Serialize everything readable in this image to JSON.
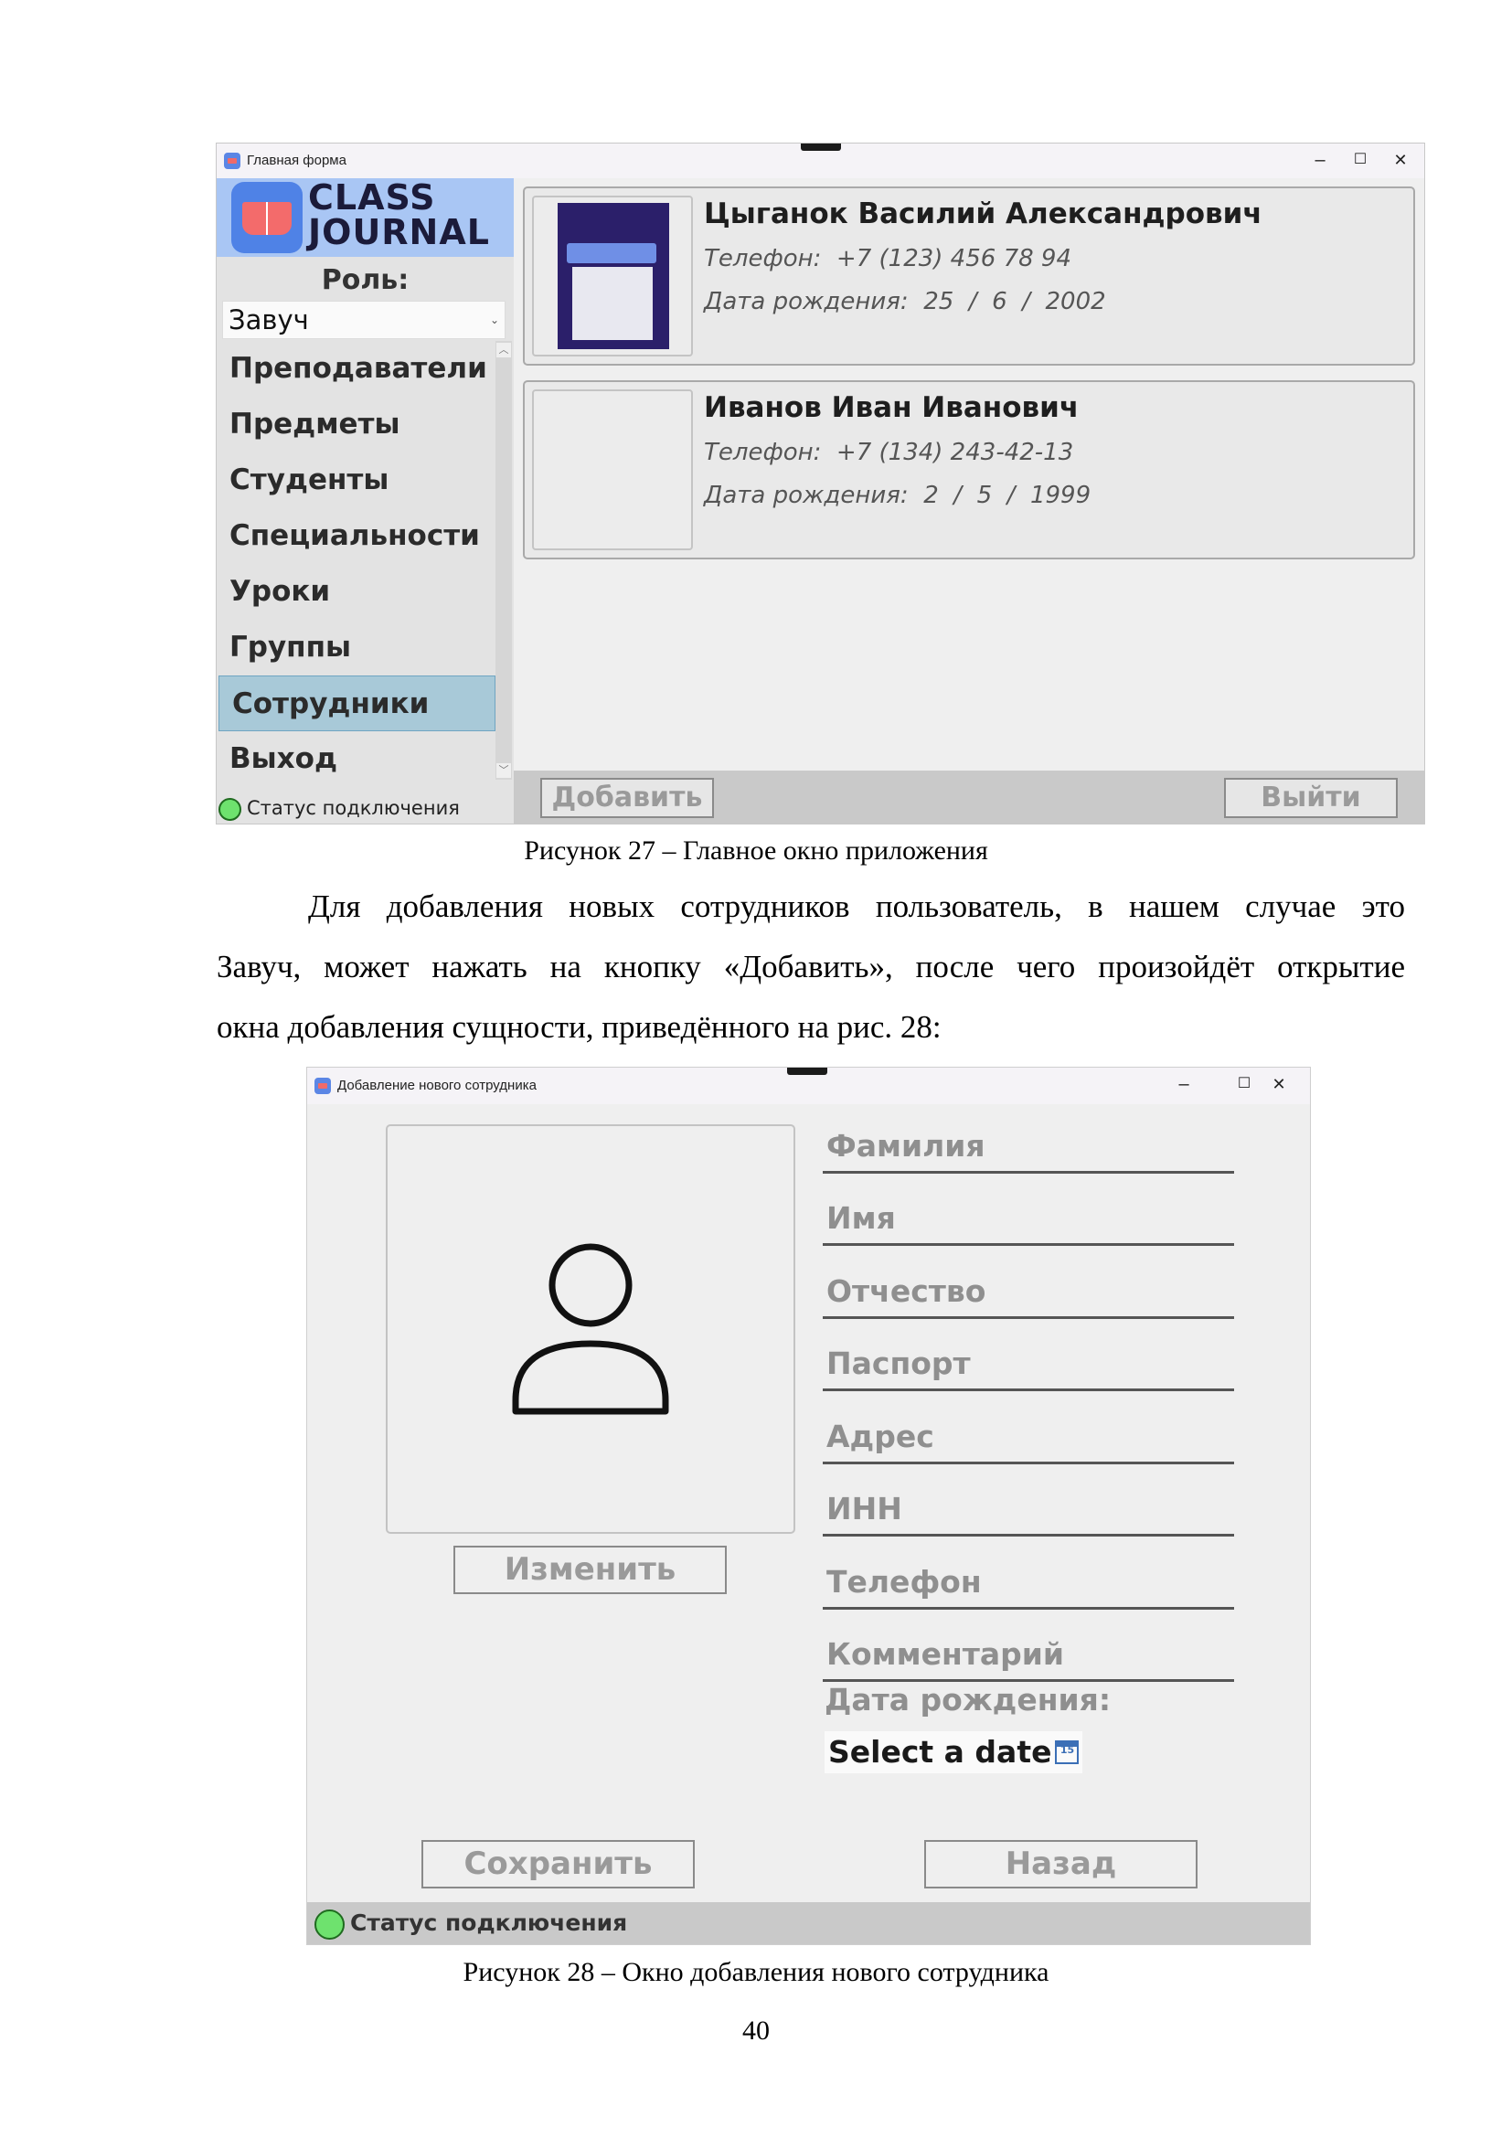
{
  "window1": {
    "title": "Главная форма",
    "controls": {
      "minimize": "–",
      "maximize": "☐",
      "close": "✕"
    },
    "logo": {
      "line1": "CLASS",
      "line2": "JOURNAL"
    },
    "role_label": "Роль:",
    "role_value": "Завуч",
    "nav": [
      "Преподаватели",
      "Предметы",
      "Студенты",
      "Специальности",
      "Уроки",
      "Группы",
      "Сотрудники",
      "Выход"
    ],
    "nav_active": "Сотрудники",
    "status": "Статус подключения",
    "cards": [
      {
        "name": "Цыганок Василий Александрович",
        "phone": "Телефон:  +7 (123) 456 78 94",
        "birth": "Дата рождения:  25  /  6  /  2002"
      },
      {
        "name": "Иванов Иван Иванович",
        "phone": "Телефон:  +7 (134) 243-42-13",
        "birth": "Дата рождения:  2  /  5  /  1999"
      }
    ],
    "add_button": "Добавить",
    "exit_button": "Выйти"
  },
  "caption1": "Рисунок 27 – Главное окно приложения",
  "paragraph": [
    "Для добавления новых сотрудников пользователь, в нашем случае это",
    "Завуч, может нажать на кнопку «Добавить», после чего произойдёт открытие",
    "окна добавления сущности, приведённого на рис. 28:"
  ],
  "window2": {
    "title": "Добавление нового сотрудника",
    "controls": {
      "minimize": "–",
      "maximize": "☐",
      "close": "✕"
    },
    "change_button": "Изменить",
    "fields": [
      "Фамилия",
      "Имя",
      "Отчество",
      "Паспорт",
      "Адрес",
      "ИНН",
      "Телефон",
      "Комментарий"
    ],
    "dob_label": "Дата рождения:",
    "date_placeholder": "Select a date",
    "calendar_day": "15",
    "save_button": "Сохранить",
    "back_button": "Назад",
    "status": "Статус подключения"
  },
  "caption2": "Рисунок 28 – Окно добавления нового сотрудника",
  "page_number": "40",
  "colors": {
    "status_ok": "#6ee26e",
    "logo_bg": "#4f82e6",
    "active_nav": "#a8c9d8"
  }
}
